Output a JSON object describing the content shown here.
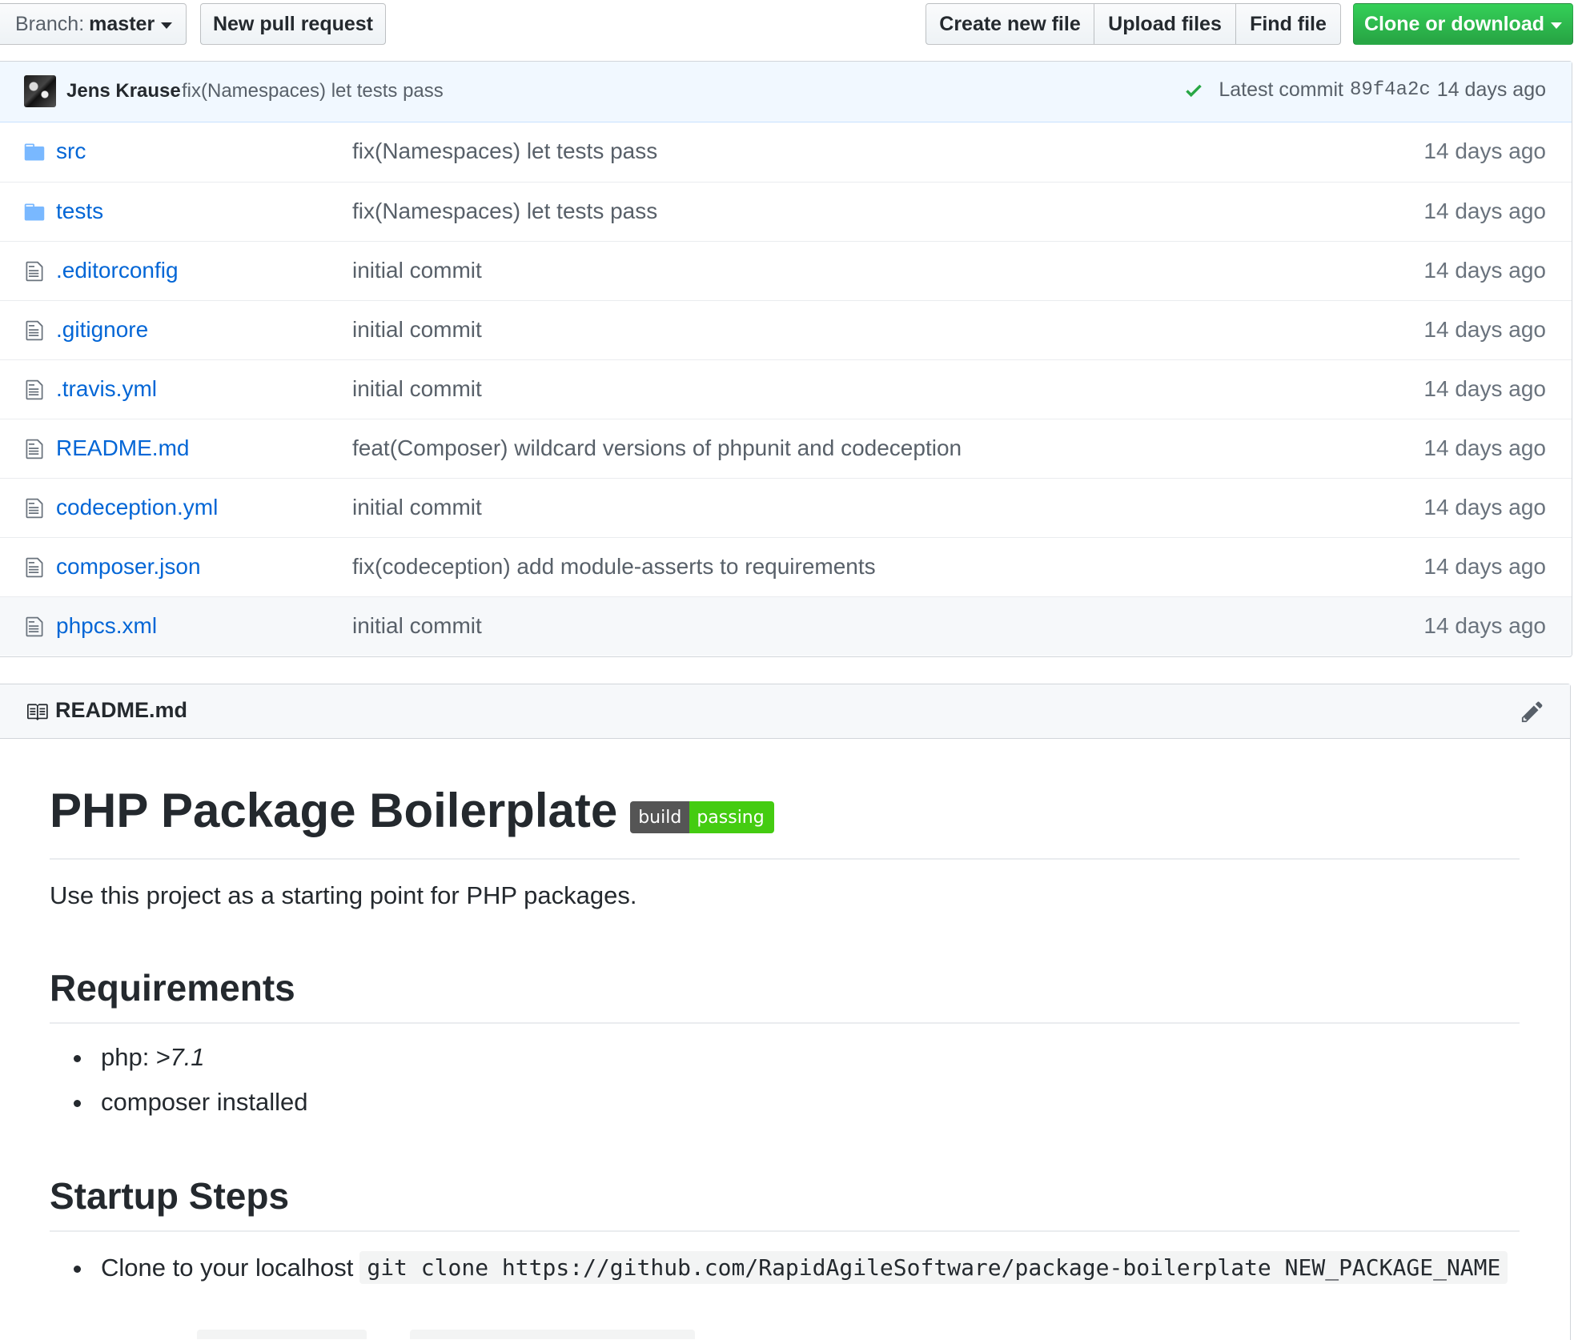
{
  "toolbar": {
    "branch_prefix": "Branch:",
    "branch_name": "master",
    "new_pull_request": "New pull request",
    "create_new_file": "Create new file",
    "upload_files": "Upload files",
    "find_file": "Find file",
    "clone_or_download": "Clone or download"
  },
  "commit": {
    "author": "Jens Krause",
    "message": "fix(Namespaces) let tests pass",
    "latest_label": "Latest commit",
    "sha": "89f4a2c",
    "age": "14 days ago"
  },
  "files": [
    {
      "name": "src",
      "type": "folder",
      "commit": "fix(Namespaces) let tests pass",
      "age": "14 days ago"
    },
    {
      "name": "tests",
      "type": "folder",
      "commit": "fix(Namespaces) let tests pass",
      "age": "14 days ago"
    },
    {
      "name": ".editorconfig",
      "type": "file",
      "commit": "initial commit",
      "age": "14 days ago"
    },
    {
      "name": ".gitignore",
      "type": "file",
      "commit": "initial commit",
      "age": "14 days ago"
    },
    {
      "name": ".travis.yml",
      "type": "file",
      "commit": "initial commit",
      "age": "14 days ago"
    },
    {
      "name": "README.md",
      "type": "file",
      "commit": "feat(Composer) wildcard versions of phpunit and codeception",
      "age": "14 days ago"
    },
    {
      "name": "codeception.yml",
      "type": "file",
      "commit": "initial commit",
      "age": "14 days ago"
    },
    {
      "name": "composer.json",
      "type": "file",
      "commit": "fix(codeception) add module-asserts to requirements",
      "age": "14 days ago"
    },
    {
      "name": "phpcs.xml",
      "type": "file",
      "commit": "initial commit",
      "age": "14 days ago"
    }
  ],
  "readme": {
    "filename": "README.md",
    "title": "PHP Package Boilerplate",
    "badge": {
      "left": "build",
      "right": "passing"
    },
    "intro": "Use this project as a starting point for PHP packages.",
    "requirements_heading": "Requirements",
    "requirements": {
      "php_label": "php:",
      "php_version": ">7.1",
      "composer": "composer installed"
    },
    "startup_heading": "Startup Steps",
    "startup": {
      "clone_label": "Clone to your localhost",
      "clone_code": "git clone https://github.com/RapidAgileSoftware/package-boilerplate NEW_PACKAGE_NAME"
    }
  },
  "colors": {
    "link": "#0366d6",
    "clone_button": "#28a745",
    "commit_bar_bg": "#f1f8ff",
    "badge_pass": "#44cc11",
    "badge_label": "#555555",
    "check": "#28a745"
  },
  "icons": {
    "folder": "folder-icon",
    "file": "file-icon",
    "check": "check-icon",
    "book": "book-icon",
    "pencil": "pencil-icon",
    "caret": "caret-down-icon"
  }
}
